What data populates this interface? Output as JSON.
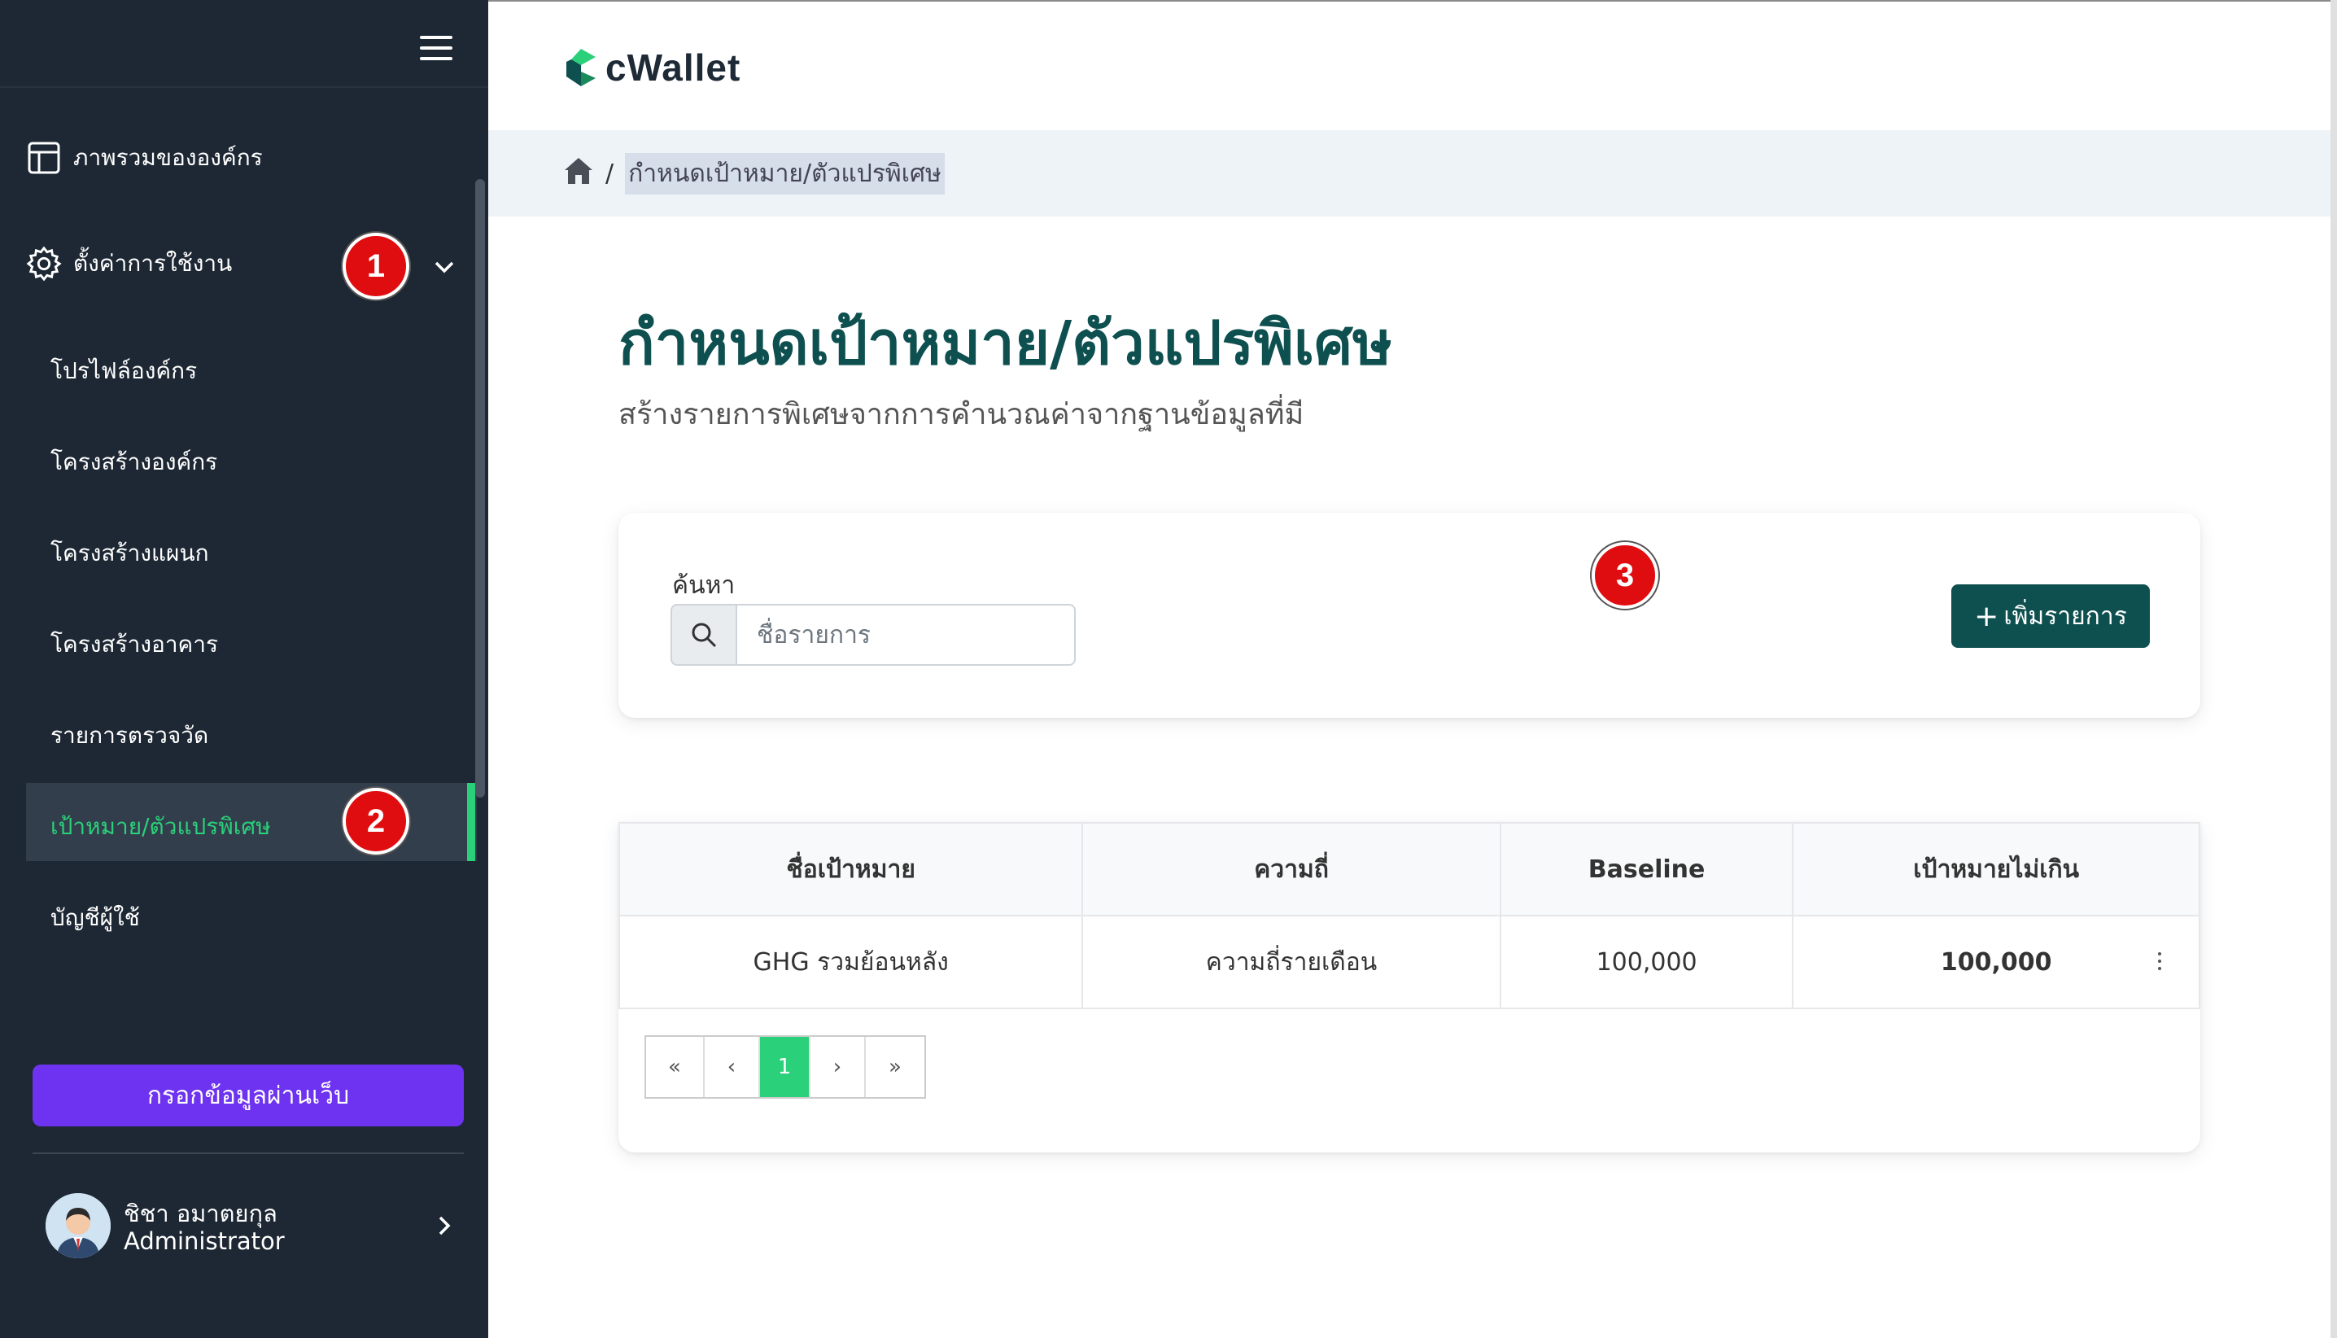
{
  "sidebar": {
    "nav": {
      "overview_label": "ภาพรวมขององค์กร",
      "settings_label": "ตั้งค่าการใช้งาน",
      "sub_items": [
        {
          "label": "โปรไฟล์องค์กร"
        },
        {
          "label": "โครงสร้างองค์กร"
        },
        {
          "label": "โครงสร้างแผนก"
        },
        {
          "label": "โครงสร้างอาคาร"
        },
        {
          "label": "รายการตรวจวัด"
        },
        {
          "label": "เป้าหมาย/ตัวแปรพิเศษ",
          "active": true
        },
        {
          "label": "บัญชีผู้ใช้"
        }
      ]
    },
    "web_button_label": "กรอกข้อมูลผ่านเว็บ",
    "user": {
      "name": "ชิชา อมาตยกุล",
      "role": "Administrator"
    },
    "accent_color": "#2bd07a"
  },
  "annotations": {
    "badge_1": "1",
    "badge_2": "2",
    "badge_3": "3"
  },
  "header": {
    "logo_text": "cWallet"
  },
  "breadcrumb": {
    "separator": "/",
    "current": "กำหนดเป้าหมาย/ตัวแปรพิเศษ"
  },
  "page": {
    "title": "กำหนดเป้าหมาย/ตัวแปรพิเศษ",
    "subtitle": "สร้างรายการพิเศษจากการคำนวณค่าจากฐานข้อมูลที่มี"
  },
  "search": {
    "label": "ค้นหา",
    "placeholder": "ชื่อรายการ",
    "add_button_label": "เพิ่มรายการ"
  },
  "table": {
    "headers": [
      "ชื่อเป้าหมาย",
      "ความถี่",
      "Baseline",
      "เป้าหมายไม่เกิน"
    ],
    "rows": [
      {
        "name": "GHG รวมย้อนหลัง",
        "frequency": "ความถี่รายเดือน",
        "baseline": "100,000",
        "target": "100,000"
      }
    ]
  },
  "pagination": {
    "first": "«",
    "prev": "‹",
    "current": "1",
    "next": "›",
    "last": "»"
  },
  "colors": {
    "sidebar_bg": "#1e2834",
    "primary": "#0e4f4f",
    "web_button": "#6d33f0",
    "badge": "#e00d10"
  }
}
